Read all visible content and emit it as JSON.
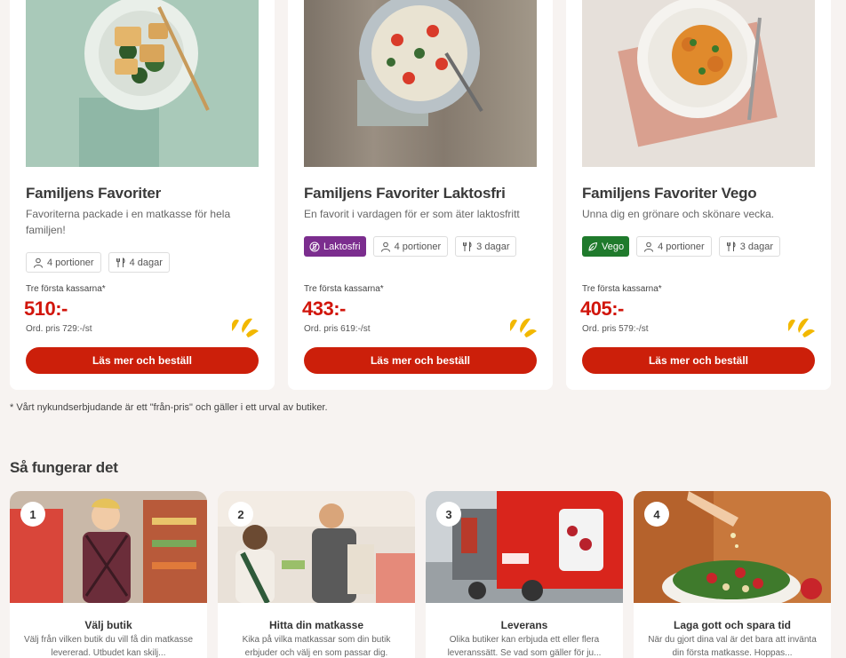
{
  "cards": [
    {
      "title": "Familjens Favoriter",
      "description": "Favoriterna packade i en matkasse för hela familjen!",
      "diet_tag": null,
      "portions": "4 portioner",
      "days": "4 dagar",
      "price_label": "Tre första kassarna*",
      "price": "510:-",
      "ordinary_price": "Ord. pris 729:-/st",
      "cta": "Läs mer och beställ"
    },
    {
      "title": "Familjens Favoriter Laktosfri",
      "description": "En favorit i vardagen för er som äter laktosfritt",
      "diet_tag": "Laktosfri",
      "portions": "4 portioner",
      "days": "3 dagar",
      "price_label": "Tre första kassarna*",
      "price": "433:-",
      "ordinary_price": "Ord. pris 619:-/st",
      "cta": "Läs mer och beställ"
    },
    {
      "title": "Familjens Favoriter Vego",
      "description": "Unna dig en grönare och skönare vecka.",
      "diet_tag": "Vego",
      "portions": "4 portioner",
      "days": "3 dagar",
      "price_label": "Tre första kassarna*",
      "price": "405:-",
      "ordinary_price": "Ord. pris 579:-/st",
      "cta": "Läs mer och beställ"
    }
  ],
  "footnote": "* Vårt nykundserbjudande är ett \"från-pris\" och gäller i ett urval av butiker.",
  "section_title": "Så fungerar det",
  "steps": [
    {
      "number": "1",
      "title": "Välj butik",
      "description": "Välj från vilken butik du vill få din matkasse levererad. Utbudet kan skilj..."
    },
    {
      "number": "2",
      "title": "Hitta din matkasse",
      "description": "Kika på vilka matkassar som din butik erbjuder och välj en som passar dig."
    },
    {
      "number": "3",
      "title": "Leverans",
      "description": "Olika butiker kan erbjuda ett eller flera leveranssätt. Se vad som gäller för ju..."
    },
    {
      "number": "4",
      "title": "Laga gott och spara tid",
      "description": "När du gjort dina val är det bara att invänta din första matkasse. Hoppas..."
    }
  ],
  "colors": {
    "accent_red": "#cc1f0a",
    "price_red": "#d1150b",
    "laktosfri_purple": "#7b2d8e",
    "vego_green": "#1f7a2c",
    "brand_yellow": "#f2b800"
  }
}
